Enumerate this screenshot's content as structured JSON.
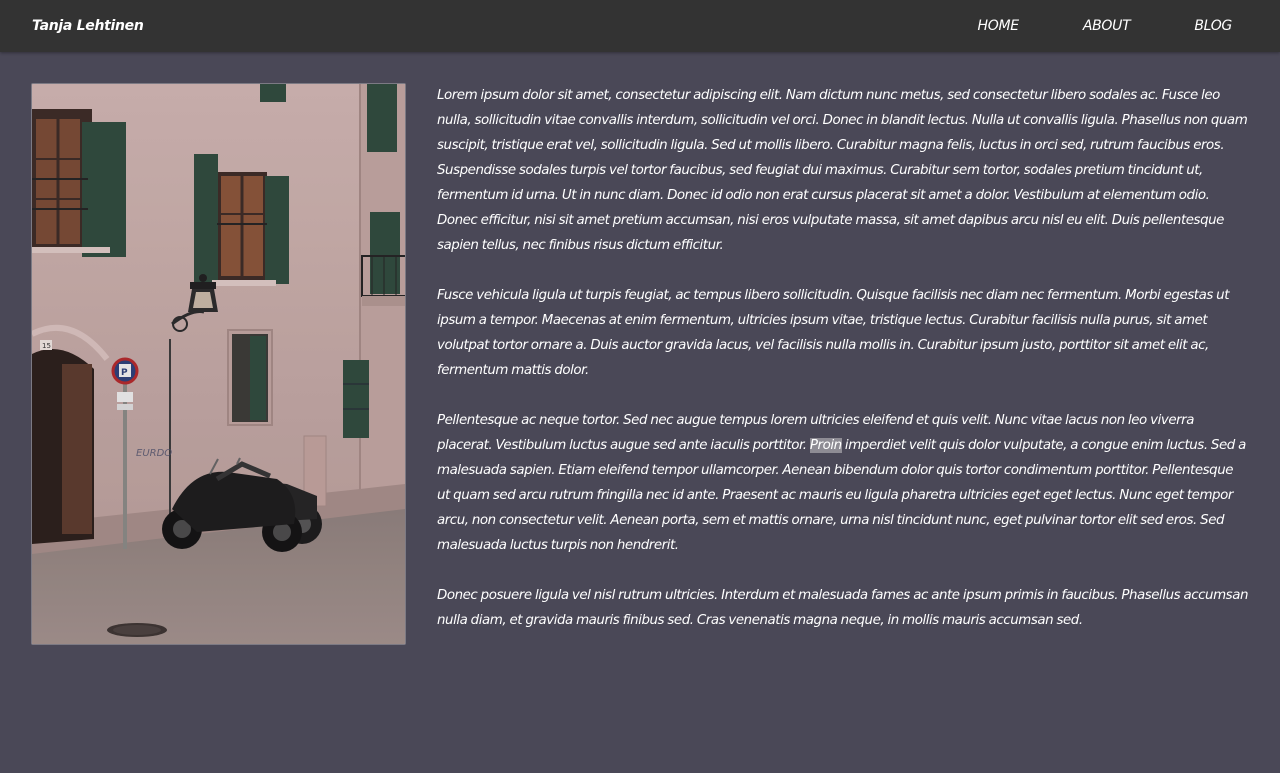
{
  "nav": {
    "brand": "Tanja Lehtinen",
    "links": [
      {
        "label": "HOME"
      },
      {
        "label": "ABOUT"
      },
      {
        "label": "BLOG"
      }
    ]
  },
  "photo": {
    "house_number": "15",
    "graffiti": "EURDO"
  },
  "content": {
    "paragraphs": [
      "Lorem ipsum dolor sit amet, consectetur adipiscing elit. Nam dictum nunc metus, sed consectetur libero sodales ac. Fusce leo nulla, sollicitudin vitae convallis interdum, sollicitudin vel orci. Donec in blandit lectus. Nulla ut convallis ligula. Phasellus non quam suscipit, tristique erat vel, sollicitudin ligula. Sed ut mollis libero. Curabitur magna felis, luctus in orci sed, rutrum faucibus eros. Suspendisse sodales turpis vel tortor faucibus, sed feugiat dui maximus. Curabitur sem tortor, sodales pretium tincidunt ut, fermentum id urna. Ut in nunc diam. Donec id odio non erat cursus placerat sit amet a dolor. Vestibulum at elementum odio. Donec efficitur, nisi sit amet pretium accumsan, nisi eros vulputate massa, sit amet dapibus arcu nisl eu elit. Duis pellentesque sapien tellus, nec finibus risus dictum efficitur.",
      "Fusce vehicula ligula ut turpis feugiat, ac tempus libero sollicitudin. Quisque facilisis nec diam nec fermentum. Morbi egestas ut ipsum a tempor. Maecenas at enim fermentum, ultricies ipsum vitae, tristique lectus. Curabitur facilisis nulla purus, sit amet volutpat tortor ornare a. Duis auctor gravida lacus, vel facilisis nulla mollis in. Curabitur ipsum justo, porttitor sit amet elit ac, fermentum mattis dolor.",
      {
        "before": "Pellentesque ac neque tortor. Sed nec augue tempus lorem ultricies eleifend et quis velit. Nunc vitae lacus non leo viverra placerat. Vestibulum luctus augue sed ante iaculis porttitor. ",
        "selected": "Proin",
        "after": " imperdiet velit quis dolor vulputate, a congue enim luctus. Sed a malesuada sapien. Etiam eleifend tempor ullamcorper. Aenean bibendum dolor quis tortor condimentum porttitor. Pellentesque ut quam sed arcu rutrum fringilla nec id ante. Praesent ac mauris eu ligula pharetra ultricies eget eget lectus. Nunc eget tempor arcu, non consectetur velit. Aenean porta, sem et mattis ornare, urna nisl tincidunt nunc, eget pulvinar tortor elit sed eros. Sed malesuada luctus turpis non hendrerit."
      },
      "Donec posuere ligula vel nisl rutrum ultricies. Interdum et malesuada fames ac ante ipsum primis in faucibus. Phasellus accumsan nulla diam, et gravida mauris finibus sed. Cras venenatis magna neque, in mollis mauris accumsan sed."
    ]
  },
  "colors": {
    "page_background": "#4a4857",
    "navbar_background": "#333333",
    "text": "#ffffff",
    "shutter_green": "#2e4a3c",
    "wall_pink": "#c8aeaa"
  }
}
